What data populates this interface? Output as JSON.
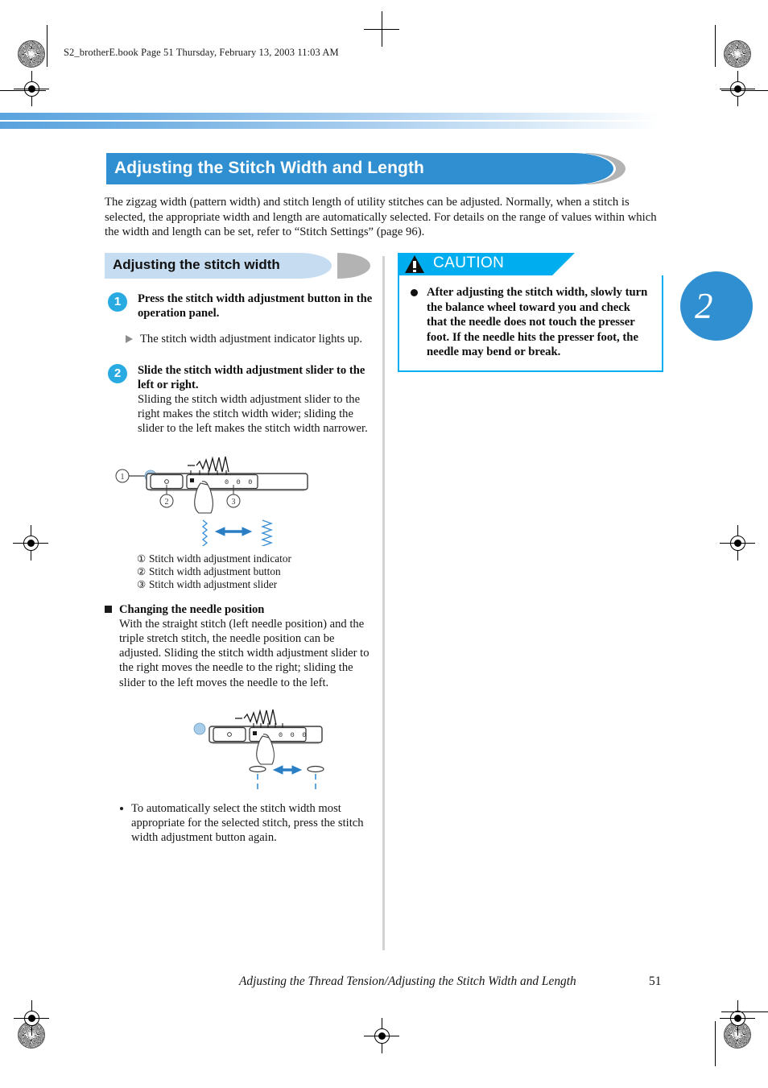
{
  "file_header": "S2_brotherE.book  Page 51  Thursday, February 13, 2003  11:03 AM",
  "chapter": {
    "number": "2"
  },
  "title": {
    "text": "Adjusting the Stitch Width and Length"
  },
  "intro": {
    "text": "The zigzag width (pattern width) and stitch length of utility stitches can be adjusted. Normally, when a stitch is selected, the appropriate width and length are automatically selected. For details on the range of values within which the width and length can be set, refer to “Stitch Settings” (page 96)."
  },
  "subsection": {
    "heading": "Adjusting the stitch width"
  },
  "steps": [
    {
      "number": "1",
      "title": "Press the stitch width adjustment button in the operation panel.",
      "result": "The stitch width adjustment indicator lights up."
    },
    {
      "number": "2",
      "title": "Slide the stitch width adjustment slider to the left or right.",
      "body": "Sliding the stitch width adjustment slider to the right makes the stitch width wider; sliding the slider to the left makes the stitch width narrower."
    }
  ],
  "diagram_1": {
    "callouts": [
      "1",
      "2",
      "3"
    ],
    "panel_display": "0 0 0"
  },
  "legend": [
    {
      "num": "①",
      "label": "Stitch width adjustment indicator"
    },
    {
      "num": "②",
      "label": "Stitch width adjustment button"
    },
    {
      "num": "③",
      "label": "Stitch width adjustment slider"
    }
  ],
  "needle_section": {
    "heading": "Changing the needle position",
    "body": "With the straight stitch (left needle position) and the triple stretch stitch, the needle position can be adjusted. Sliding the stitch width adjustment slider to the right moves the needle to the right; sliding the slider to the left moves the needle to the left."
  },
  "diagram_2": {
    "panel_display": "0 0 0"
  },
  "note": {
    "text": "To automatically select the stitch width most appropriate for the selected stitch, press the stitch width adjustment button again."
  },
  "caution": {
    "label": "CAUTION",
    "item": "After adjusting the stitch width, slowly turn the balance wheel toward you and check that the needle does not touch the presser foot. If the needle hits the presser foot, the needle may bend or break."
  },
  "footer": {
    "running_title": "Adjusting the Thread Tension/Adjusting the Stitch Width and Length",
    "page_number": "51"
  },
  "colors": {
    "title_blue": "#2f8fd0",
    "sub_blue": "#c6dcf0",
    "cap_gray": "#b3b3b3",
    "step_badge": "#29abe2",
    "caution_cyan": "#00aeef",
    "diagram_blue": "#3b8fd4"
  }
}
